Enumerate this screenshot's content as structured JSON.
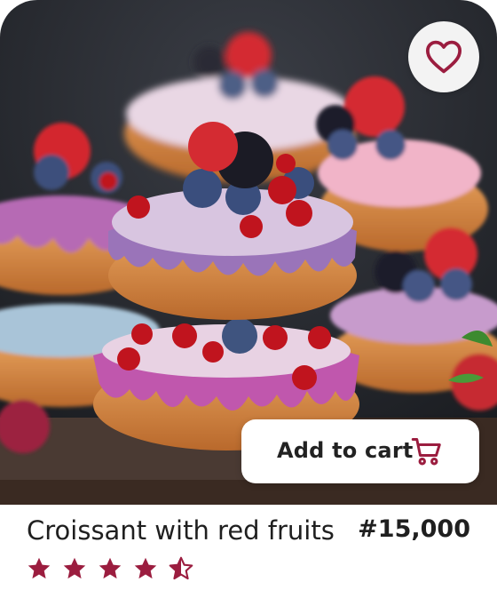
{
  "product": {
    "name": "Croissant with red fruits",
    "price": "#15,000",
    "rating": 4.5,
    "rating_max": 5
  },
  "actions": {
    "add_to_cart_label": "Add to cart"
  },
  "icons": {
    "favorite": "heart-outline-icon",
    "cart": "shopping-cart-icon",
    "star": "star-icon"
  },
  "colors": {
    "accent": "#9b1d3f",
    "text": "#1f1f1f"
  }
}
